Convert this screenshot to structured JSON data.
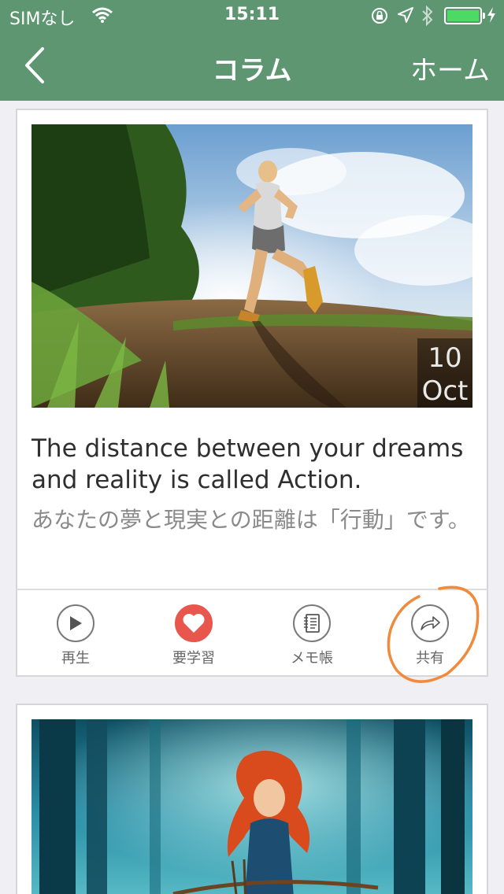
{
  "status": {
    "carrier": "SIMなし",
    "time": "15:11",
    "battery_level": 1.0,
    "icons": [
      "wifi-icon",
      "orientation-lock-icon",
      "location-arrow-icon",
      "bluetooth-icon",
      "battery-icon",
      "charging-bolt-icon"
    ]
  },
  "nav": {
    "back_icon": "chevron-left-icon",
    "title": "コラム",
    "home": "ホーム"
  },
  "cards": [
    {
      "image": "runner-on-trail-photo",
      "date_day": "10",
      "date_month": "Oct",
      "quote_en": "The distance between your dreams and reality is called Action.",
      "quote_ja": "あなたの夢と現実との距離は「行動」です。",
      "actions": [
        {
          "icon": "play-icon",
          "label": "再生"
        },
        {
          "icon": "heart-icon",
          "label": "要学習",
          "color": "#e8574e"
        },
        {
          "icon": "notebook-icon",
          "label": "メモ帳"
        },
        {
          "icon": "share-arrow-icon",
          "label": "共有"
        }
      ]
    },
    {
      "image": "archer-girl-forest-photo"
    }
  ],
  "colors": {
    "header": "#5e9672",
    "accent_red": "#e8574e",
    "annotation": "#f08a3c"
  }
}
